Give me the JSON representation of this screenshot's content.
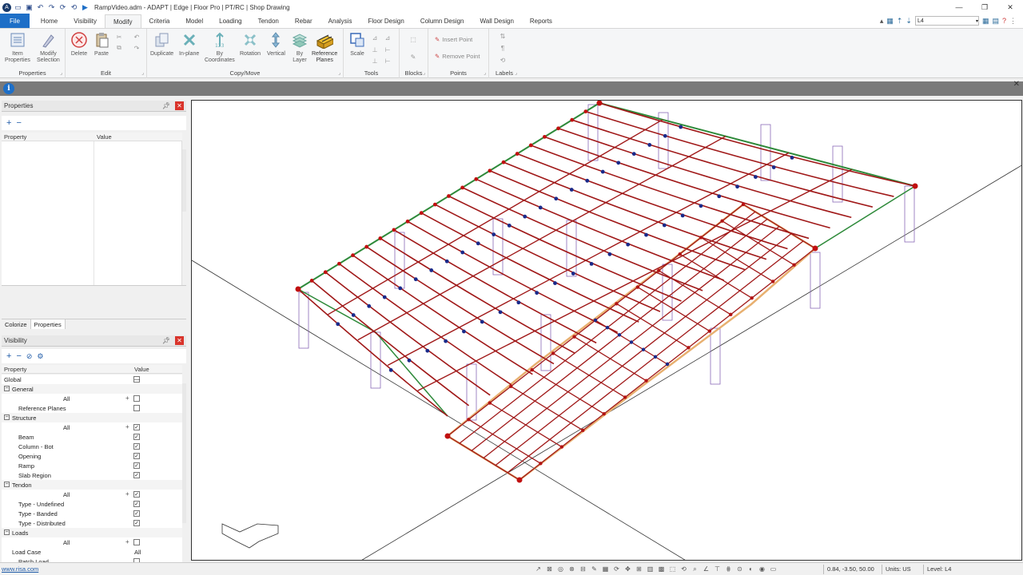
{
  "window": {
    "title": "RampVideo.adm - ADAPT | Edge | Floor Pro | PT/RC | Shop Drawing",
    "minimize": "—",
    "restore": "❐",
    "close": "✕"
  },
  "menu": {
    "tabs": [
      "File",
      "Home",
      "Visibility",
      "Modify",
      "Criteria",
      "Model",
      "Loading",
      "Tendon",
      "Rebar",
      "Analysis",
      "Floor Design",
      "Column Design",
      "Wall Design",
      "Reports"
    ],
    "active": "Modify",
    "level_value": "L4"
  },
  "ribbon": {
    "properties": {
      "label": "Properties",
      "item_properties": "Item\nProperties",
      "modify_selection": "Modify\nSelection"
    },
    "edit": {
      "label": "Edit",
      "delete": "Delete",
      "paste": "Paste"
    },
    "copy_move": {
      "label": "Copy/Move",
      "duplicate": "Duplicate",
      "in_plane": "In-plane",
      "by_coordinates": "By\nCoordinates",
      "rotation": "Rotation",
      "vertical": "Vertical",
      "by_layer": "By\nLayer",
      "reference_planes": "Reference\nPlanes"
    },
    "tools": {
      "label": "Tools",
      "scale": "Scale"
    },
    "blocks": {
      "label": "Blocks"
    },
    "points": {
      "label": "Points",
      "insert_point": "Insert Point",
      "remove_point": "Remove Point"
    },
    "labels": {
      "label": "Labels"
    }
  },
  "properties_panel": {
    "title": "Properties",
    "col_property": "Property",
    "col_value": "Value",
    "tabs": [
      "Colorize",
      "Properties"
    ],
    "active_tab": "Properties"
  },
  "visibility_panel": {
    "title": "Visibility",
    "col_property": "Property",
    "col_value": "Value",
    "rows": [
      {
        "type": "item",
        "label": "Global",
        "indent": 0,
        "check": "—"
      },
      {
        "type": "group",
        "label": "General"
      },
      {
        "type": "all",
        "label": "All",
        "check": ""
      },
      {
        "type": "item",
        "label": "Reference Planes",
        "indent": 1,
        "check": ""
      },
      {
        "type": "group",
        "label": "Structure"
      },
      {
        "type": "all",
        "label": "All",
        "check": "✓"
      },
      {
        "type": "item",
        "label": "Beam",
        "indent": 1,
        "check": "✓"
      },
      {
        "type": "item",
        "label": "Column - Bot",
        "indent": 1,
        "check": "✓"
      },
      {
        "type": "item",
        "label": "Opening",
        "indent": 1,
        "check": "✓"
      },
      {
        "type": "item",
        "label": "Ramp",
        "indent": 1,
        "check": "✓"
      },
      {
        "type": "item",
        "label": "Slab Region",
        "indent": 1,
        "check": "✓"
      },
      {
        "type": "group",
        "label": "Tendon"
      },
      {
        "type": "all",
        "label": "All",
        "check": "✓"
      },
      {
        "type": "item",
        "label": "Type - Undefined",
        "indent": 1,
        "check": "✓"
      },
      {
        "type": "item",
        "label": "Type - Banded",
        "indent": 1,
        "check": "✓"
      },
      {
        "type": "item",
        "label": "Type - Distributed",
        "indent": 1,
        "check": "✓"
      },
      {
        "type": "group",
        "label": "Loads"
      },
      {
        "type": "all",
        "label": "All",
        "check": ""
      },
      {
        "type": "value",
        "label": "Load Case",
        "value": "All"
      },
      {
        "type": "item",
        "label": "Patch Load",
        "indent": 1,
        "check": ""
      }
    ]
  },
  "link": "www.risa.com",
  "statusbar": {
    "coords": "0.84, -3.50, 50.00",
    "units": "Units: US",
    "level": "Level: L4"
  },
  "colors": {
    "tendon": "#a01818",
    "tendon_node": "#c01010",
    "profile_point": "#1a2a8a",
    "column": "#8a6ab8",
    "slab_edge": "#2e8a3a",
    "ramp_band": "#e8b070",
    "file_tab": "#1e6fc7"
  }
}
